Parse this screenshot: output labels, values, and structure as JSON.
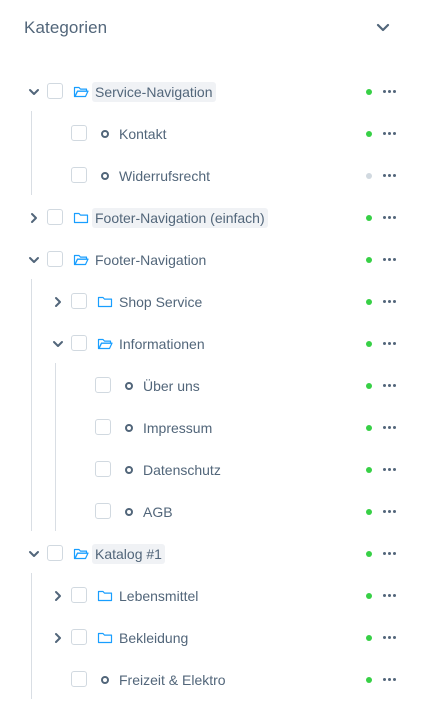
{
  "header": {
    "title": "Kategorien",
    "collapse_icon": "chevron-down-icon"
  },
  "colors": {
    "text": "#52667a",
    "folder": "#189eff",
    "status_active": "#37d046",
    "status_inactive": "#d1d9e0",
    "guide_line": "#d9dee4"
  },
  "tree": [
    {
      "id": "service-navigation",
      "label": "Service-Navigation",
      "depth": 0,
      "kind": "folder",
      "expandable": true,
      "expanded": true,
      "highlight": true,
      "active": true
    },
    {
      "id": "kontakt",
      "label": "Kontakt",
      "depth": 1,
      "kind": "leaf",
      "expandable": false,
      "expanded": false,
      "highlight": false,
      "active": true
    },
    {
      "id": "widerrufsrecht",
      "label": "Widerrufsrecht",
      "depth": 1,
      "kind": "leaf",
      "expandable": false,
      "expanded": false,
      "highlight": false,
      "active": false
    },
    {
      "id": "footer-navigation-einfach",
      "label": "Footer-Navigation (einfach)",
      "depth": 0,
      "kind": "folder",
      "expandable": true,
      "expanded": false,
      "highlight": true,
      "active": true
    },
    {
      "id": "footer-navigation",
      "label": "Footer-Navigation",
      "depth": 0,
      "kind": "folder",
      "expandable": true,
      "expanded": true,
      "highlight": false,
      "active": true
    },
    {
      "id": "shop-service",
      "label": "Shop Service",
      "depth": 1,
      "kind": "folder",
      "expandable": true,
      "expanded": false,
      "highlight": false,
      "active": true
    },
    {
      "id": "informationen",
      "label": "Informationen",
      "depth": 1,
      "kind": "folder",
      "expandable": true,
      "expanded": true,
      "highlight": false,
      "active": true
    },
    {
      "id": "ueber-uns",
      "label": "Über uns",
      "depth": 2,
      "kind": "leaf",
      "expandable": false,
      "expanded": false,
      "highlight": false,
      "active": true
    },
    {
      "id": "impressum",
      "label": "Impressum",
      "depth": 2,
      "kind": "leaf",
      "expandable": false,
      "expanded": false,
      "highlight": false,
      "active": true
    },
    {
      "id": "datenschutz",
      "label": "Datenschutz",
      "depth": 2,
      "kind": "leaf",
      "expandable": false,
      "expanded": false,
      "highlight": false,
      "active": true
    },
    {
      "id": "agb",
      "label": "AGB",
      "depth": 2,
      "kind": "leaf",
      "expandable": false,
      "expanded": false,
      "highlight": false,
      "active": true
    },
    {
      "id": "katalog-1",
      "label": "Katalog #1",
      "depth": 0,
      "kind": "folder",
      "expandable": true,
      "expanded": true,
      "highlight": true,
      "active": true
    },
    {
      "id": "lebensmittel",
      "label": "Lebensmittel",
      "depth": 1,
      "kind": "folder",
      "expandable": true,
      "expanded": false,
      "highlight": false,
      "active": true
    },
    {
      "id": "bekleidung",
      "label": "Bekleidung",
      "depth": 1,
      "kind": "folder",
      "expandable": true,
      "expanded": false,
      "highlight": false,
      "active": true
    },
    {
      "id": "freizeit-elektro",
      "label": "Freizeit & Elektro",
      "depth": 1,
      "kind": "leaf",
      "expandable": false,
      "expanded": false,
      "highlight": false,
      "active": true
    }
  ]
}
